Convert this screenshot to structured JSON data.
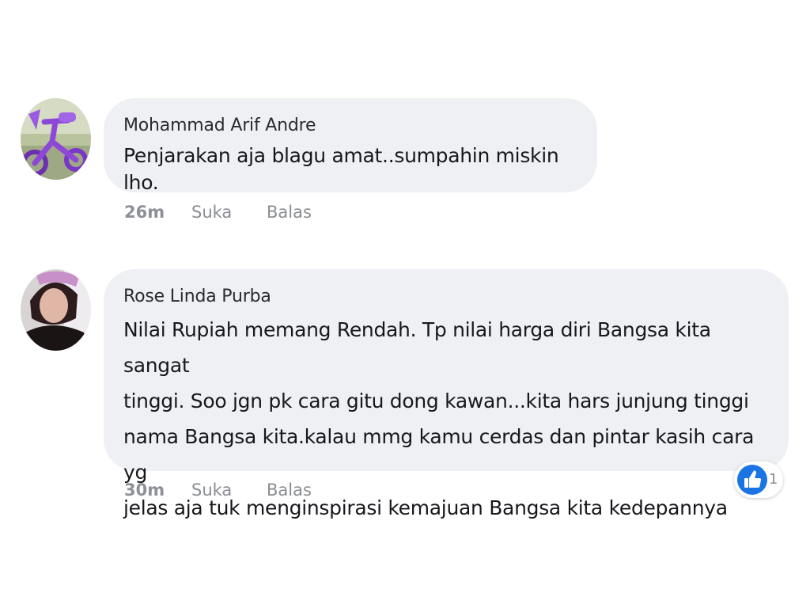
{
  "comments": [
    {
      "author": "Mohammad Arif Andre",
      "text": "Penjarakan aja blagu amat..sumpahin miskin lho.",
      "time": "26m",
      "like_label": "Suka",
      "reply_label": "Balas",
      "avatar_icon": "avatar-photo-purple-bicycle"
    },
    {
      "author": "Rose Linda Purba",
      "text_lines": [
        "Nilai Rupiah memang Rendah. Tp nilai harga diri Bangsa kita sangat",
        "tinggi. Soo jgn pk  cara gitu dong kawan...kita hars junjung tinggi",
        "nama Bangsa kita.kalau mmg kamu cerdas dan pintar kasih cara yg",
        "jelas aja tuk menginspirasi kemajuan Bangsa kita kedepannya"
      ],
      "time": "30m",
      "like_label": "Suka",
      "reply_label": "Balas",
      "avatar_icon": "avatar-photo-woman",
      "reaction": {
        "icon": "thumbs-up-icon",
        "count": "1",
        "color": "#1b74e4"
      }
    }
  ]
}
